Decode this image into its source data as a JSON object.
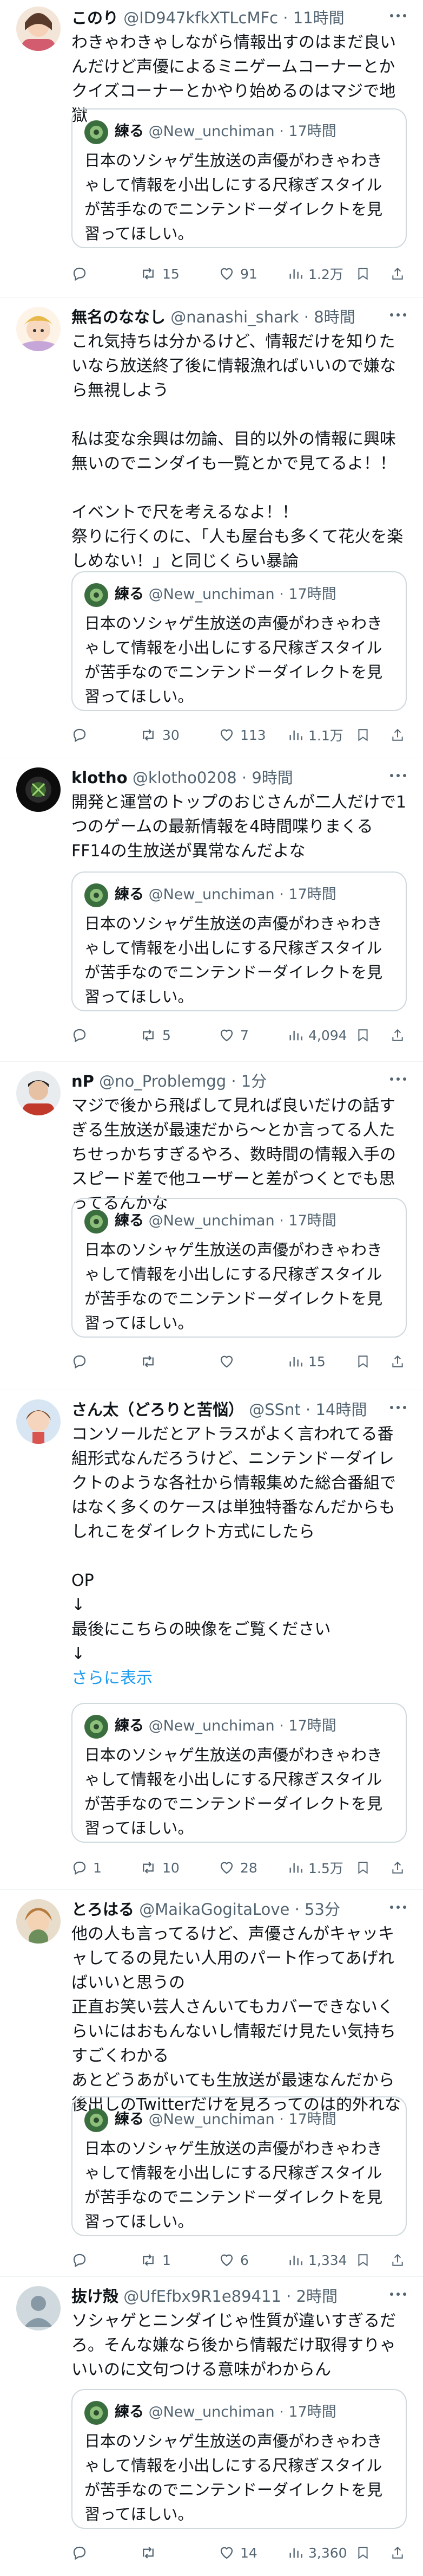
{
  "quoted": {
    "name": "練る",
    "handle": "@New_unchiman",
    "time": "17時間",
    "text": "日本のソシャゲ生放送の声優がわきゃわきゃして情報を小出しにする尺稼ぎスタイルが苦手なのでニンテンドーダイレクトを見習ってほしい。"
  },
  "tweets": [
    {
      "name": "このり",
      "handle": "@ID947kfkXTLcMFc",
      "time": "11時間",
      "text": "わきゃわきゃしながら情報出すのはまだ良いんだけど声優によるミニゲームコーナーとかクイズコーナーとかやり始めるのはマジで地獄",
      "show_more": "",
      "replies": "",
      "retweets": "15",
      "likes": "91",
      "views": "1.2万"
    },
    {
      "name": "無名のななし",
      "handle": "@nanashi_shark",
      "time": "8時間",
      "text": "これ気持ちは分かるけど、情報だけを知りたいなら放送終了後に情報漁ればいいので嫌なら無視しよう\n\n私は変な余興は勿論、目的以外の情報に興味無いのでニンダイも一覧とかで見てるよ！！\n\nイベントで尺を考えるなよ！！\n祭りに行くのに、「人も屋台も多くて花火を楽しめない！」と同じくらい暴論",
      "show_more": "",
      "replies": "",
      "retweets": "30",
      "likes": "113",
      "views": "1.1万"
    },
    {
      "name": "klotho",
      "handle": "@klotho0208",
      "time": "9時間",
      "text": "開発と運営のトップのおじさんが二人だけで1つのゲームの最新情報を4時間喋りまくるFF14の生放送が異常なんだよな",
      "show_more": "",
      "replies": "",
      "retweets": "5",
      "likes": "7",
      "views": "4,094"
    },
    {
      "name": "nP",
      "handle": "@no_Problemgg",
      "time": "1分",
      "text": "マジで後から飛ばして見れば良いだけの話すぎる生放送が最速だから〜とか言ってる人たちせっかちすぎるやろ、数時間の情報入手のスピード差で他ユーザーと差がつくとでも思ってるんかな",
      "show_more": "",
      "replies": "",
      "retweets": "",
      "likes": "",
      "views": "15"
    },
    {
      "name": "さん太（どろりと苦悩）",
      "handle": "@SSnt",
      "time": "14時間",
      "text": "コンソールだとアトラスがよく言われてる番組形式なんだろうけど、ニンテンドーダイレクトのような各社から情報集めた総合番組ではなく多くのケースは単独特番なんだからもしれこをダイレクト方式にしたら\n\nOP\n↓\n最後にこちらの映像をご覧ください\n↓",
      "show_more": "さらに表示",
      "replies": "1",
      "retweets": "10",
      "likes": "28",
      "views": "1.5万"
    },
    {
      "name": "とろはる",
      "handle": "@MaikaGogitaLove",
      "time": "53分",
      "text": "他の人も言ってるけど、声優さんがキャッキャしてるの見たい人用のパート作ってあげればいいと思うの\n正直お笑い芸人さんいてもカバーできないくらいにはおもんないし情報だけ見たい気持ちすごくわかる\nあとどうあがいても生放送が最速なんだから後出しのTwitterだけを見ろってのは的外れな",
      "show_more": "",
      "replies": "",
      "retweets": "1",
      "likes": "6",
      "views": "1,334"
    },
    {
      "name": "抜け殻",
      "handle": "@UfEfbx9R1e89411",
      "time": "2時間",
      "text": "ソシャゲとニンダイじゃ性質が違いすぎるだろ。そんな嫌なら後から情報だけ取得すりゃいいのに文句つける意味がわからん",
      "show_more": "",
      "replies": "",
      "retweets": "",
      "likes": "",
      "views": "3,360"
    }
  ],
  "last_tweet_likes": "14",
  "colors": {
    "text": "#0f1419",
    "meta": "#536471",
    "link": "#1d9bf0",
    "border": "#cfd9de"
  }
}
